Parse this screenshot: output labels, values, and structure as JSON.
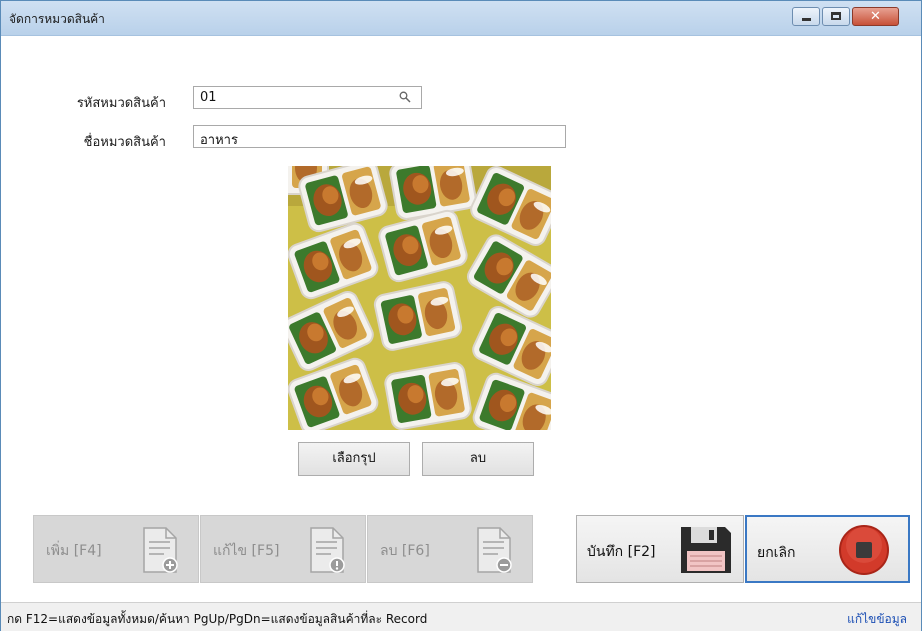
{
  "window": {
    "title": "จัดการหมวดสินค้า",
    "controls": {
      "minimize": "minimize",
      "maximize": "maximize",
      "close": "✕"
    }
  },
  "form": {
    "code_label": "รหัสหมวดสินค้า",
    "code_value": "01",
    "name_label": "ชื่อหมวดสินค้า",
    "name_value": "อาหาร"
  },
  "image": {
    "alt": "food-boxes-photo",
    "choose_label": "เลือกรุป",
    "delete_label": "ลบ"
  },
  "toolbar": {
    "add_label": "เพิ่ม [F4]",
    "edit_label": "แก้ไข [F5]",
    "delete_label": "ลบ [F6]",
    "save_label": "บันทึก [F2]",
    "cancel_label": "ยกเลิก"
  },
  "icons": {
    "add": "document-add-icon",
    "edit": "document-edit-icon",
    "delete": "document-remove-icon",
    "save": "floppy-disk-icon",
    "cancel": "stop-icon"
  },
  "status": {
    "hint": "กด F12=แสดงข้อมูลทั้งหมด/ค้นหา  PgUp/PgDn=แสดงข้อมูลสินค้าที่ละ Record",
    "mode": "แก้ไขข้อมูล"
  },
  "colors": {
    "accent": "#3a78c4",
    "close_button": "#c75138",
    "stop_red": "#d23a2a",
    "status_link": "#1c4fb4"
  }
}
